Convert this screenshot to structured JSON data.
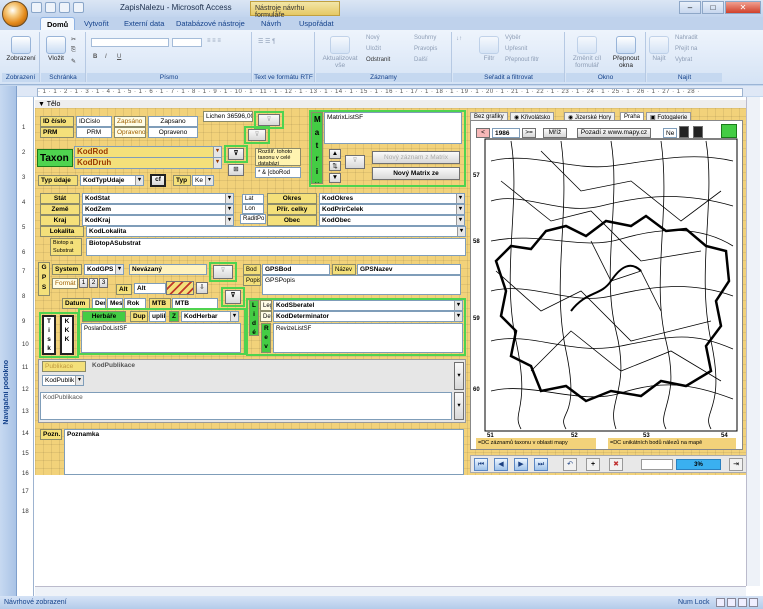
{
  "titlebar": {
    "title": "ZapisNalezu - Microsoft Access",
    "context_tab": "Nástroje návrhu formuláře"
  },
  "tabs": [
    "Domů",
    "Vytvořit",
    "Externí data",
    "Databázové nástroje",
    "Návrh",
    "Uspořádat"
  ],
  "ribbon": {
    "groups": [
      "Zobrazení",
      "Schránka",
      "Písmo",
      "Text ve formátu RTF",
      "Záznamy",
      "Seřadit a filtrovat",
      "Okno",
      "Najít"
    ],
    "buttons": {
      "view": "Zobrazení",
      "paste": "Vložit",
      "refresh": "Aktualizovat vše",
      "new": "Nový",
      "save": "Uložit",
      "delete": "Odstranit",
      "totals": "Souhrny",
      "spelling": "Pravopis",
      "more": "Další",
      "filter": "Filtr",
      "selection": "Výběr",
      "advanced": "Upřesnit",
      "toggle_filter": "Přepnout filtr",
      "fit_form": "Změnit cíl formulář",
      "switch_windows": "Přepnout okna",
      "find": "Najít",
      "replace": "Nahradit",
      "goto": "Přejít na",
      "select": "Vybrat"
    }
  },
  "nav_pane": "Navigační podokno",
  "section": "Tělo",
  "ruler": "· 1 · 1 · 2 · 1 · 3 · 1 · 4 · 1 · 5 · 1 · 6 · 1 · 7 · 1 · 8 · 1 · 9 · 1 · 10 · 1 · 11 · 1 · 12 · 1 · 13 · 1 · 14 · 1 · 15 · 1 · 16 · 1 · 17 · 1 · 18 · 1 · 19 · 1 · 20 · 1 · 21 · 1 · 22 · 1 · 23 · 1 · 24 · 1 · 25 · 1 · 26 · 1 · 27 · 1 · 28 ·",
  "vruler": [
    "1",
    "2",
    "3",
    "4",
    "5",
    "6",
    "7",
    "8",
    "9",
    "10",
    "11",
    "12",
    "13",
    "14",
    "15",
    "16",
    "17",
    "18"
  ],
  "form": {
    "id_label": "ID číslo",
    "id_field": "IDCislo",
    "zapsano_label": "Zapsáno",
    "zapsano_field": "Zapsano",
    "prm_label": "PRM",
    "prm_field": "PRM",
    "opraveno_label": "Opraveno",
    "opraveno_field": "Opraveno",
    "lichen": "Lichen 36596,00",
    "taxon_label": "Taxon",
    "kodrod": "KodRod",
    "koddruh": "KodDruh",
    "note_rozsah": "Rozšíř. tohoto taxonu v celé databázi",
    "cborod": "* & [cboRod",
    "typ_udaje_label": "Typ údaje",
    "typ_udaje_field": "KodTypUdaje",
    "cf": "cf",
    "typ_label": "Typ",
    "ke": "Ke",
    "stat_label": "Stát",
    "stat_field": "KodStat",
    "zeme_label": "Země",
    "zeme_field": "KodZem",
    "kraj_label": "Kraj",
    "kraj_field": "KodKraj",
    "lat": "Lat",
    "lon": "Lon",
    "radit": "RaditPo",
    "okres_label": "Okres",
    "okres_field": "KodOkres",
    "prir_label": "Přír. celky",
    "prir_field": "KodPrirCelek",
    "obec_label": "Obec",
    "obec_field": "KodObec",
    "lokalita_label": "Lokalita",
    "lokalita_field": "KodLokalita",
    "biotop_label": "Biotop a Substrat",
    "biotop_field": "BiotopASubstrat",
    "system_label": "System",
    "system_field": "KodGPS",
    "nevazany": "Nevázaný",
    "format_label": "Formát",
    "f1": "1",
    "f2": "2",
    "f3": "3",
    "alt_label": "Alt",
    "alt_field": "Alt",
    "gps_letters": "G P S",
    "bod_label": "Bod",
    "bod_field": "GPSBod",
    "nazev_label": "Název",
    "nazev_field": "GPSNazev",
    "popis_label": "Popis",
    "popis_field": "GPSPopis",
    "datum_label": "Datum",
    "den": "Den",
    "mesic": "Mesi",
    "rok": "Rok",
    "mtb_label": "MTB",
    "mtb_field": "MTB",
    "herbare_label": "Herbáře",
    "dup_label": "Dup",
    "dup_field": "uplik",
    "z_label": "Z",
    "herbar_field": "KodHerbar",
    "leg_label": "Leg",
    "leg_field": "KodSberatel",
    "det_label": "Det",
    "det_field": "KodDeterminator",
    "lide": "L i d é",
    "rev": "R e v",
    "revize": "RevizeListSF",
    "tisk": "T i s k",
    "kkk": "K K K",
    "poslano": "PoslanDoListSF",
    "publikace_label": "Publikace",
    "publikace_field": "KodPublikace",
    "kodpublikace2": "KodPublik",
    "kodpublikace3": "KodPublikace",
    "pozn_label": "Pozn.",
    "pozn_field": "Poznamka",
    "matrix_letters": "M a t r i x",
    "matrix_list": "MatrixListSF",
    "new_record_matrix": "Nový záznam z Matrix",
    "new_matrix_ze": "Nový Matrix ze"
  },
  "map": {
    "tabs": [
      "Bez grafiky",
      "Křivolátsko",
      "Jizerské Hory",
      "Praha",
      "Fotogalerie"
    ],
    "year_prev": "<",
    "year": "1986",
    "year_ge": ">=",
    "mrz": "Mříž",
    "pozadi": "Pozadí z www.mapy.cz",
    "ne": "Ne",
    "grid_left": [
      "57",
      "58",
      "59",
      "60"
    ],
    "grid_bottom": [
      "51",
      "52",
      "53",
      "54"
    ],
    "caption_left": "=DC záznamů taxonu v oblasti mapy",
    "caption_right": "=DC unikátních bodů nálezů na mapě",
    "progress": "3%"
  },
  "status": {
    "left": "Návrhové zobrazení",
    "right": "Num Lock"
  }
}
